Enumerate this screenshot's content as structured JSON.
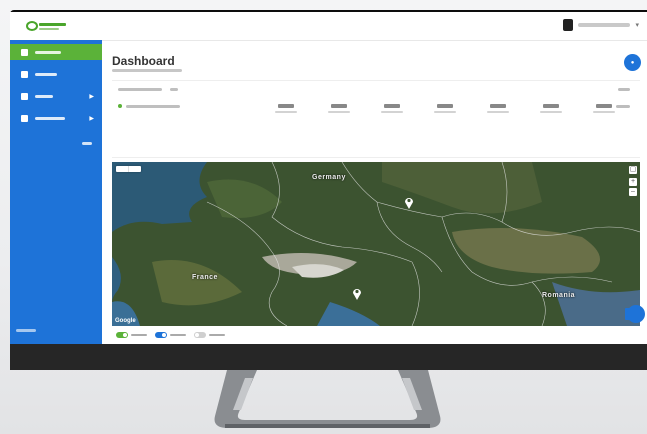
{
  "header": {
    "logo_icon": "brand-logo-icon",
    "user_icon": "user-avatar-icon",
    "user_name": ""
  },
  "sidebar": {
    "items": [
      {
        "label": "",
        "icon": "globe-icon",
        "active": true
      },
      {
        "label": "",
        "icon": "people-icon",
        "active": false
      },
      {
        "label": "",
        "icon": "report-icon",
        "active": false,
        "expandable": true
      },
      {
        "label": "",
        "icon": "gear-icon",
        "active": false,
        "expandable": true
      }
    ],
    "footer": ""
  },
  "page": {
    "title": "Dashboard",
    "subtitle": ""
  },
  "map": {
    "labels": {
      "germany": "Germany",
      "france": "France",
      "romania": "Romania"
    },
    "attribution": "Google"
  },
  "colors": {
    "sidebar": "#1e73d8",
    "active_item": "#5bb239",
    "accent": "#1e73d8"
  }
}
